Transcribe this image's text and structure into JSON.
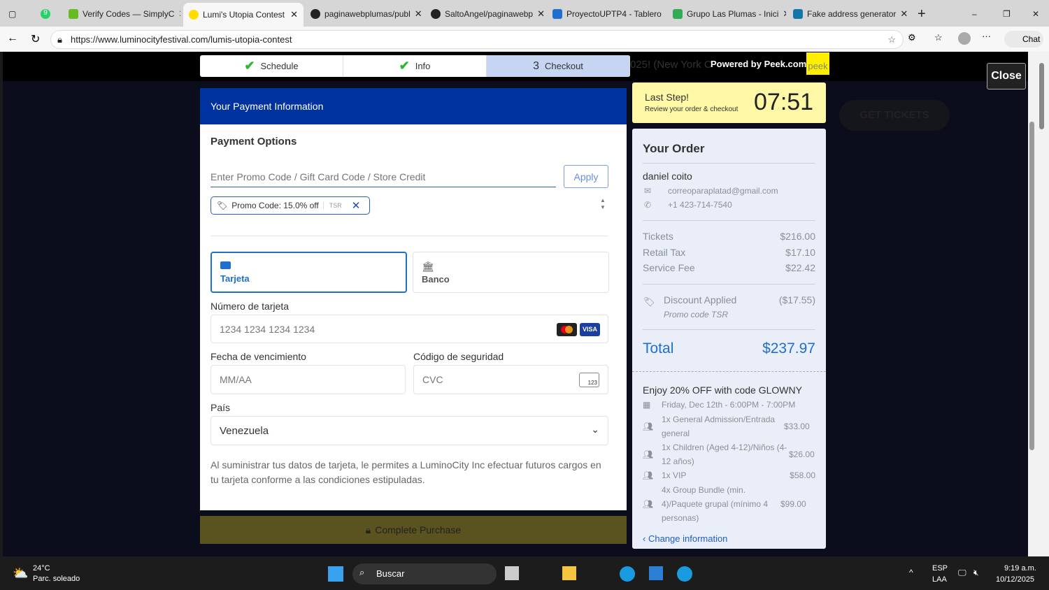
{
  "browser": {
    "tabs": [
      {
        "label": "Verify Codes — SimplyC"
      },
      {
        "label": "Lumi's Utopia Contest",
        "active": true
      },
      {
        "label": "paginawebplumas/publ"
      },
      {
        "label": "SaltoAngel/paginawebp"
      },
      {
        "label": "ProyectoUPTP4 - Tablero"
      },
      {
        "label": "Grupo Las Plumas - Inici"
      },
      {
        "label": "Fake address generator"
      }
    ],
    "whatsapp_badge": "9",
    "url": "https://www.luminocityfestival.com/lumis-utopia-contest",
    "chat_label": "Chat"
  },
  "steps": [
    {
      "label": "Schedule",
      "done": true
    },
    {
      "label": "Info",
      "done": true
    },
    {
      "num": "3",
      "label": "Checkout",
      "current": true
    }
  ],
  "background_text": "025! (New York C",
  "powered_by": "Powered by Peek.com",
  "peek_logo": "peek",
  "close_label": "Close",
  "get_tickets": "GET TICKETS",
  "payment": {
    "header": "Your Payment Information",
    "options_title": "Payment Options",
    "promo_placeholder": "Enter Promo Code / Gift Card Code / Store Credit",
    "apply_label": "Apply",
    "promo_chip": "Promo Code: 15.0% off",
    "promo_chip_code": "TSR",
    "methods": [
      {
        "label": "Tarjeta",
        "selected": true
      },
      {
        "label": "Banco"
      }
    ],
    "card_label": "Número de tarjeta",
    "card_placeholder": "1234 1234 1234 1234",
    "expiry_label": "Fecha de vencimiento",
    "expiry_placeholder": "MM/AA",
    "cvc_label": "Código de seguridad",
    "cvc_placeholder": "CVC",
    "cvc_icon_text": "123",
    "country_label": "País",
    "country_value": "Venezuela",
    "visa": "VISA",
    "disclaimer": "Al suministrar tus datos de tarjeta, le permites a LuminoCity Inc efectuar futuros cargos en tu tarjeta conforme a las condiciones estipuladas.",
    "complete_label": "Complete Purchase"
  },
  "timer": {
    "title": "Last Step!",
    "subtitle": "Review your order & checkout",
    "time": "07:51"
  },
  "order": {
    "title": "Your Order",
    "name": "daniel coito",
    "email": "correoparaplatad@gmail.com",
    "phone": "+1 423-714-7540",
    "lines": [
      {
        "label": "Tickets",
        "value": "$216.00"
      },
      {
        "label": "Retail Tax",
        "value": "$17.10"
      },
      {
        "label": "Service Fee",
        "value": "$22.42"
      }
    ],
    "discount_label": "Discount Applied",
    "discount_value": "($17.55)",
    "discount_sub": "Promo code TSR",
    "total_label": "Total",
    "total_value": "$237.97",
    "promo_banner": "Enjoy 20% OFF with code GLOWNY",
    "date": "Friday, Dec 12th - 6:00PM - 7:00PM",
    "items": [
      {
        "name": "1x General Admission/Entrada general",
        "price": "$33.00"
      },
      {
        "name": "1x Children (Aged 4-12)/Niños (4-12 años)",
        "price": "$26.00"
      },
      {
        "name": "1x VIP",
        "price": "$58.00"
      },
      {
        "name": "4x Group Bundle (min. 4)/Paquete grupal (mínimo 4 personas)",
        "price": "$99.00"
      }
    ],
    "change_label": "Change information"
  },
  "taskbar": {
    "temp": "24°C",
    "weather": "Parc. soleado",
    "search": "Buscar",
    "lang1": "ESP",
    "lang2": "LAA",
    "time": "9:19 a.m.",
    "date": "10/12/2025"
  },
  "colors": {
    "header_blue": "#0033a0",
    "accent": "#1f6fce",
    "timer_bg": "#fdf7a6",
    "peek_yellow": "#ffee00"
  }
}
